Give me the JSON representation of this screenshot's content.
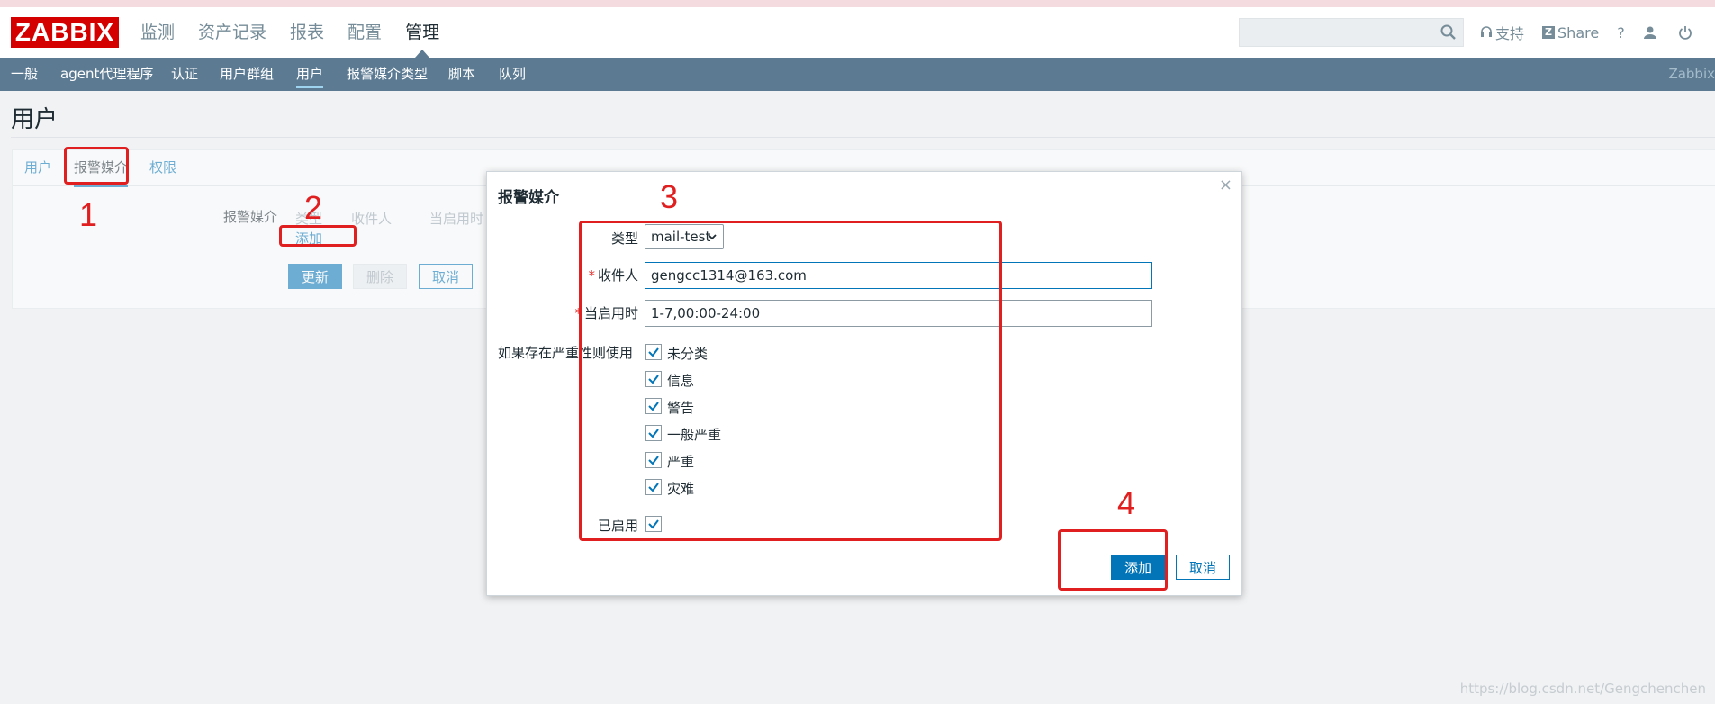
{
  "header": {
    "logo": "ZABBIX",
    "menu": [
      "监测",
      "资产记录",
      "报表",
      "配置",
      "管理"
    ],
    "active_menu": "管理",
    "search_placeholder": "",
    "support_label": "支持",
    "share_label": "Share",
    "help_label": "?"
  },
  "subnav": {
    "items": [
      "一般",
      "agent代理程序",
      "认证",
      "用户群组",
      "用户",
      "报警媒介类型",
      "脚本",
      "队列"
    ],
    "active": "用户",
    "brand": "Zabbix"
  },
  "page": {
    "title": "用户",
    "tabs": [
      "用户",
      "报警媒介",
      "权限"
    ],
    "active_tab": "报警媒介",
    "media_label": "报警媒介",
    "media_columns": [
      "类型",
      "收件人",
      "当启用时"
    ],
    "add_link": "添加",
    "buttons": {
      "update": "更新",
      "delete": "删除",
      "cancel": "取消"
    }
  },
  "dialog": {
    "title": "报警媒介",
    "close": "×",
    "type_label": "类型",
    "type_value": "mail-test",
    "sendto_label": "收件人",
    "sendto_value": "gengcc1314@163.com",
    "when_label": "当启用时",
    "when_value": "1-7,00:00-24:00",
    "severity_label": "如果存在严重性则使用",
    "severities": [
      {
        "label": "未分类",
        "checked": true
      },
      {
        "label": "信息",
        "checked": true
      },
      {
        "label": "警告",
        "checked": true
      },
      {
        "label": "一般严重",
        "checked": true
      },
      {
        "label": "严重",
        "checked": true
      },
      {
        "label": "灾难",
        "checked": true
      }
    ],
    "enabled_label": "已启用",
    "enabled": true,
    "add_button": "添加",
    "cancel_button": "取消"
  },
  "annotations": [
    "1",
    "2",
    "3",
    "4"
  ],
  "annotation_color": "#e02020",
  "accent_color": "#0275b8",
  "subnav_color": "#5c7b93",
  "watermark": "https://blog.csdn.net/Gengchenchen"
}
